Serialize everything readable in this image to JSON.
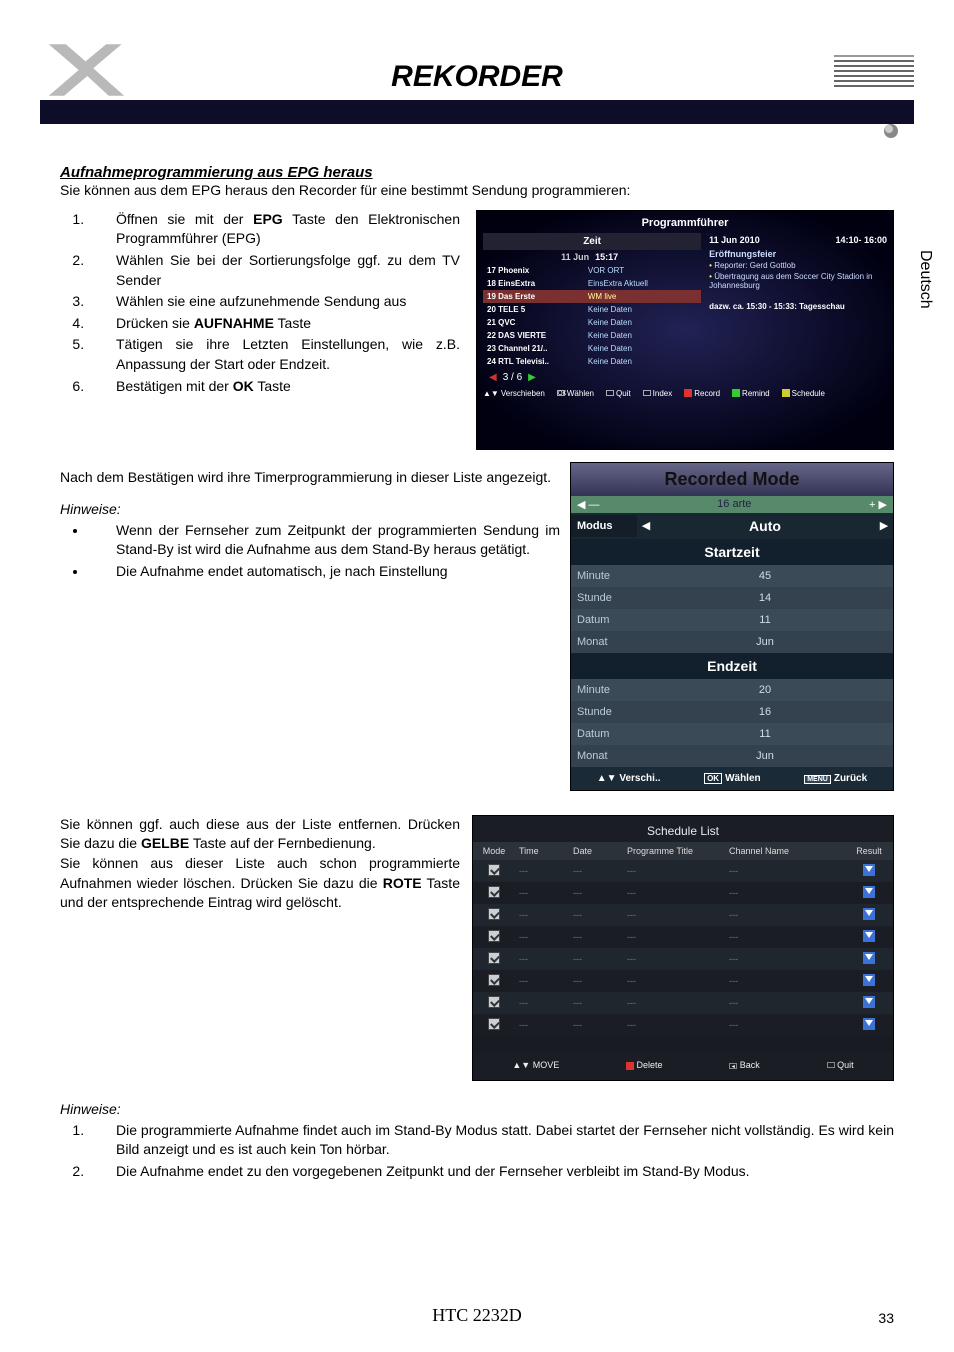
{
  "page": {
    "title": "REKORDER",
    "side_tab": "Deutsch",
    "footer_model": "HTC 2232D",
    "page_number": "33"
  },
  "section": {
    "heading": "Aufnahmeprogrammierung aus EPG heraus",
    "intro": "Sie können aus dem EPG heraus den Recorder für eine bestimmt Sendung programmieren:",
    "steps": [
      "Öffnen sie mit der <b>EPG</b> Taste den Elektronischen Programmführer (EPG)",
      "Wählen Sie bei der Sortierungsfolge ggf. zu dem TV Sender",
      "Wählen sie eine aufzunehmende Sendung aus",
      "Drücken sie <b>AUFNAHME</b> Taste",
      "Tätigen sie ihre Letzten Einstellungen, wie z.B. Anpassung der Start oder Endzeit.",
      "Bestätigen mit der <b>OK</b> Taste"
    ],
    "after_confirm": "Nach dem Bestätigen wird ihre Timerprogrammierung in dieser Liste angezeigt.",
    "hints_heading": "Hinweise:",
    "hints1": [
      "Wenn der Fernseher zum Zeitpunkt der programmierten Sendung im Stand-By ist wird die Aufnahme aus dem Stand-By heraus getätigt.",
      "Die Aufnahme endet automatisch, je nach Einstellung"
    ],
    "list_remove": "Sie können ggf. auch diese aus der Liste entfernen. Drücken Sie dazu die <b>GELBE</b> Taste auf der Fernbedienung.\nSie können aus dieser Liste auch schon programmierte Aufnahmen wieder löschen. Drücken Sie dazu die <b>ROTE</b> Taste und der entsprechende Eintrag wird gelöscht.",
    "hints2": [
      "Die programmierte Aufnahme findet auch im Stand-By Modus statt. Dabei startet der Fernseher nicht vollständig. Es wird kein Bild anzeigt und es ist auch kein Ton hörbar.",
      "Die Aufnahme endet zu den vorgegebenen Zeitpunkt und der Fernseher verbleibt im Stand-By Modus."
    ]
  },
  "epg": {
    "title": "Programmführer",
    "zeit_label": "Zeit",
    "date": "11 Jun",
    "time": "15:17",
    "channels": [
      {
        "num": "17",
        "name": "Phoenix",
        "prog": "VOR ORT"
      },
      {
        "num": "18",
        "name": "EinsExtra",
        "prog": "EinsExtra Aktuell"
      },
      {
        "num": "19",
        "name": "Das Erste",
        "prog": "WM live",
        "selected": true
      },
      {
        "num": "20",
        "name": "TELE 5",
        "prog": "Keine Daten"
      },
      {
        "num": "21",
        "name": "QVC",
        "prog": "Keine Daten"
      },
      {
        "num": "22",
        "name": "DAS VIERTE",
        "prog": "Keine Daten"
      },
      {
        "num": "23",
        "name": "Channel 21/..",
        "prog": "Keine Daten"
      },
      {
        "num": "24",
        "name": "RTL Televisi..",
        "prog": "Keine Daten"
      }
    ],
    "info": {
      "date": "11 Jun 2010",
      "timerange": "14:10- 16:00",
      "headline": "Eröffnungsfeier",
      "lines": [
        "Reporter: Gerd Gottlob",
        "Übertragung aus dem Soccer City Stadion in Johannesburg"
      ],
      "dazw": "dazw. ca. 15:30 - 15:33: Tagesschau"
    },
    "pager": "3  /  6",
    "footer": {
      "verschieben": "Verschieben",
      "waehlen": "Wählen",
      "quit": "Quit",
      "index": "Index",
      "record": "Record",
      "remind": "Remind",
      "schedule": "Schedule"
    }
  },
  "recorded": {
    "title": "Recorded Mode",
    "channel": "16 arte",
    "modus_label": "Modus",
    "modus_value": "Auto",
    "start_label": "Startzeit",
    "end_label": "Endzeit",
    "rows": {
      "minute": "Minute",
      "stunde": "Stunde",
      "datum": "Datum",
      "monat": "Monat"
    },
    "start": {
      "minute": "45",
      "stunde": "14",
      "datum": "11",
      "monat": "Jun"
    },
    "end": {
      "minute": "20",
      "stunde": "16",
      "datum": "11",
      "monat": "Jun"
    },
    "footer": {
      "verschi": "Verschi..",
      "waehlen": "Wählen",
      "zurueck": "Zurück"
    }
  },
  "schedule": {
    "title": "Schedule List",
    "columns": {
      "mode": "Mode",
      "time": "Time",
      "date": "Date",
      "prog": "Programme Title",
      "chan": "Channel Name",
      "result": "Result"
    },
    "rows": [
      "---",
      "---",
      "---",
      "---",
      "---",
      "---",
      "---",
      "---"
    ],
    "footer": {
      "move": "MOVE",
      "delete": "Delete",
      "back": "Back",
      "quit": "Quit"
    }
  }
}
